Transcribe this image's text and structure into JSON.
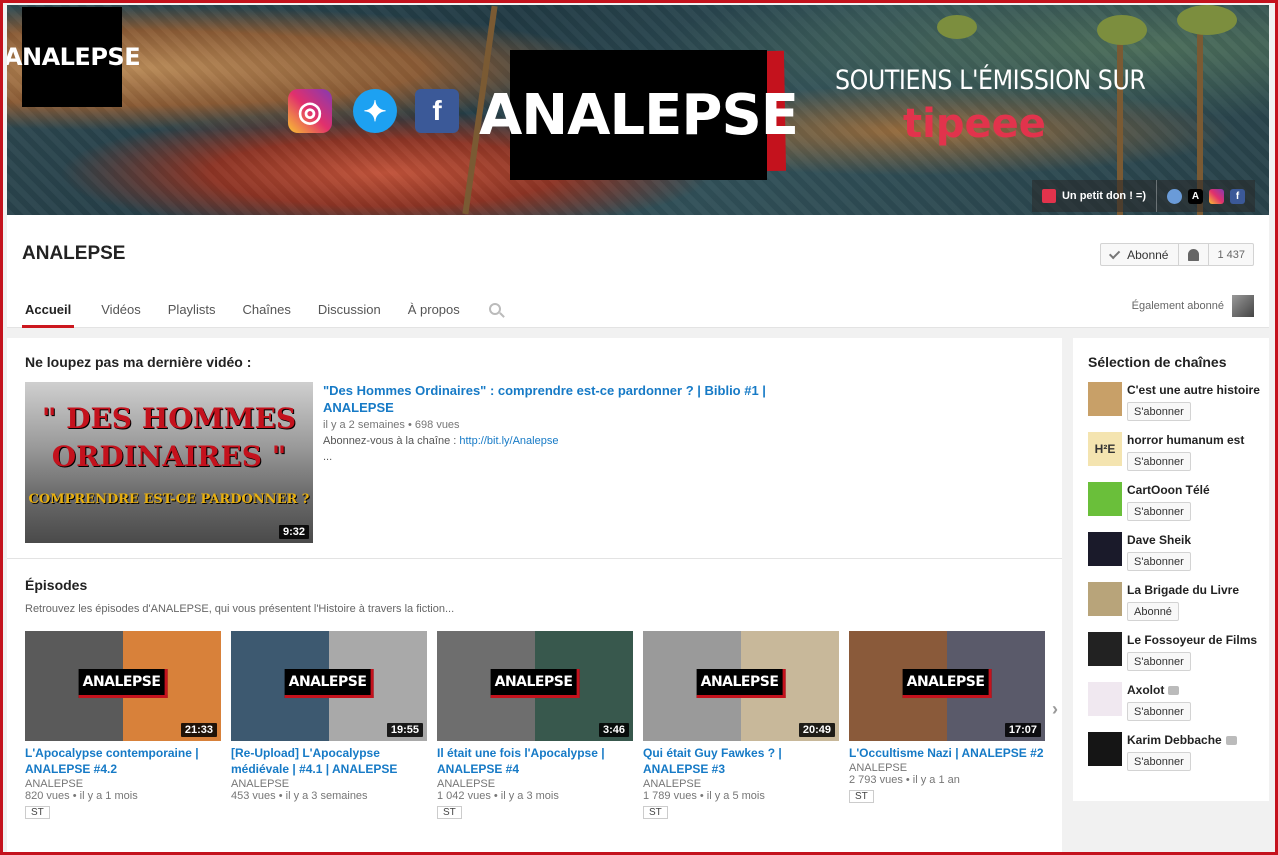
{
  "banner": {
    "logo_text": "ANALEPSE",
    "big_logo_text": "ANALEPSE",
    "support_text": "SOUTIENS L'ÉMISSION SUR",
    "tipeee_text": "tipeee",
    "don_link": "Un petit don ! =)",
    "mini_a": "A"
  },
  "channel": {
    "title": "ANALEPSE",
    "subscribe_label": "Abonné",
    "subscriber_count": "1 437",
    "also_subscribed": "Également abonné",
    "tabs": [
      "Accueil",
      "Vidéos",
      "Playlists",
      "Chaînes",
      "Discussion",
      "À propos"
    ]
  },
  "latest": {
    "section_title": "Ne loupez pas ma dernière vidéo :",
    "thumb_line1": "\" DES HOMMES",
    "thumb_line2": "ORDINAIRES \"",
    "thumb_line3": "COMPRENDRE EST-CE PARDONNER ?",
    "duration": "9:32",
    "title": "\"Des Hommes Ordinaires\" : comprendre est-ce pardonner ? | Biblio #1 | ANALEPSE",
    "age": "il y a 2 semaines",
    "views": "698 vues",
    "desc_prefix": "Abonnez-vous à la chaîne : ",
    "desc_link": "http://bit.ly/Analepse",
    "desc_more": "..."
  },
  "episodes": {
    "section_title": "Épisodes",
    "description": "Retrouvez les épisodes d'ANALEPSE, qui vous présentent l'Histoire à travers la fiction...",
    "logo_text": "ANALEPSE",
    "items": [
      {
        "title": "L'Apocalypse contemporaine | ANALEPSE #4.2",
        "channel": "ANALEPSE",
        "views": "820 vues",
        "age": "il y a 1 mois",
        "duration": "21:33",
        "badge": "ST",
        "colors": [
          "#5a5a5a",
          "#d8813a"
        ]
      },
      {
        "title": "[Re-Upload] L'Apocalypse médiévale | #4.1 | ANALEPSE",
        "channel": "ANALEPSE",
        "views": "453 vues",
        "age": "il y a 3 semaines",
        "duration": "19:55",
        "badge": "",
        "colors": [
          "#3d5970",
          "#a9a9a9"
        ]
      },
      {
        "title": "Il était une fois l'Apocalypse | ANALEPSE #4",
        "channel": "ANALEPSE",
        "views": "1 042 vues",
        "age": "il y a 3 mois",
        "duration": "3:46",
        "badge": "ST",
        "colors": [
          "#6e6e6e",
          "#38584d"
        ]
      },
      {
        "title": "Qui était Guy Fawkes ? | ANALEPSE #3",
        "channel": "ANALEPSE",
        "views": "1 789 vues",
        "age": "il y a 5 mois",
        "duration": "20:49",
        "badge": "ST",
        "colors": [
          "#9a9a9a",
          "#c8b89a"
        ]
      },
      {
        "title": "L'Occultisme Nazi | ANALEPSE #2",
        "channel": "ANALEPSE",
        "views": "2 793 vues",
        "age": "il y a 1 an",
        "duration": "17:07",
        "badge": "ST",
        "colors": [
          "#8a5a3a",
          "#5a5a6a"
        ]
      }
    ]
  },
  "sidebar": {
    "title": "Sélection de chaînes",
    "channels": [
      {
        "name": "C'est une autre histoire",
        "button": "S'abonner",
        "verified": false,
        "color": "#c8a068"
      },
      {
        "name": "horror humanum est",
        "button": "S'abonner",
        "verified": false,
        "color": "#f4e4b0",
        "badge_text": "H²E"
      },
      {
        "name": "CartOoon Télé",
        "button": "S'abonner",
        "verified": false,
        "color": "#6abf3a"
      },
      {
        "name": "Dave Sheik",
        "button": "S'abonner",
        "verified": false,
        "color": "#1a1a2a"
      },
      {
        "name": "La Brigade du Livre",
        "button": "Abonné",
        "verified": false,
        "color": "#b8a47a"
      },
      {
        "name": "Le Fossoyeur de Films",
        "button": "S'abonner",
        "verified": false,
        "color": "#222222"
      },
      {
        "name": "Axolot",
        "button": "S'abonner",
        "verified": true,
        "color": "#f0e8f0"
      },
      {
        "name": "Karim Debbache",
        "button": "S'abonner",
        "verified": true,
        "color": "#151515"
      }
    ]
  }
}
